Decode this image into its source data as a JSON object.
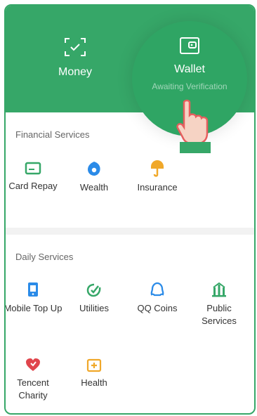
{
  "header": {
    "money_label": "Money",
    "wallet_label": "Wallet",
    "wallet_status": "Awaiting Verification"
  },
  "financial": {
    "title": "Financial Services",
    "items": [
      {
        "label": "Card Repay",
        "icon": "card-icon"
      },
      {
        "label": "Wealth",
        "icon": "wealth-icon"
      },
      {
        "label": "Insurance",
        "icon": "insurance-icon"
      }
    ]
  },
  "daily": {
    "title": "Daily Services",
    "items": [
      {
        "label": "Mobile Top Up",
        "icon": "mobile-icon"
      },
      {
        "label": "Utilities",
        "icon": "utilities-icon"
      },
      {
        "label": "QQ Coins",
        "icon": "qq-icon"
      },
      {
        "label": "Public Services",
        "icon": "public-services-icon"
      },
      {
        "label": "Tencent Charity",
        "icon": "charity-icon"
      },
      {
        "label": "Health",
        "icon": "health-icon"
      }
    ]
  },
  "colors": {
    "brand_green": "#36a768",
    "blue": "#2b8be8",
    "orange": "#f0a82a",
    "red": "#e0454c"
  }
}
